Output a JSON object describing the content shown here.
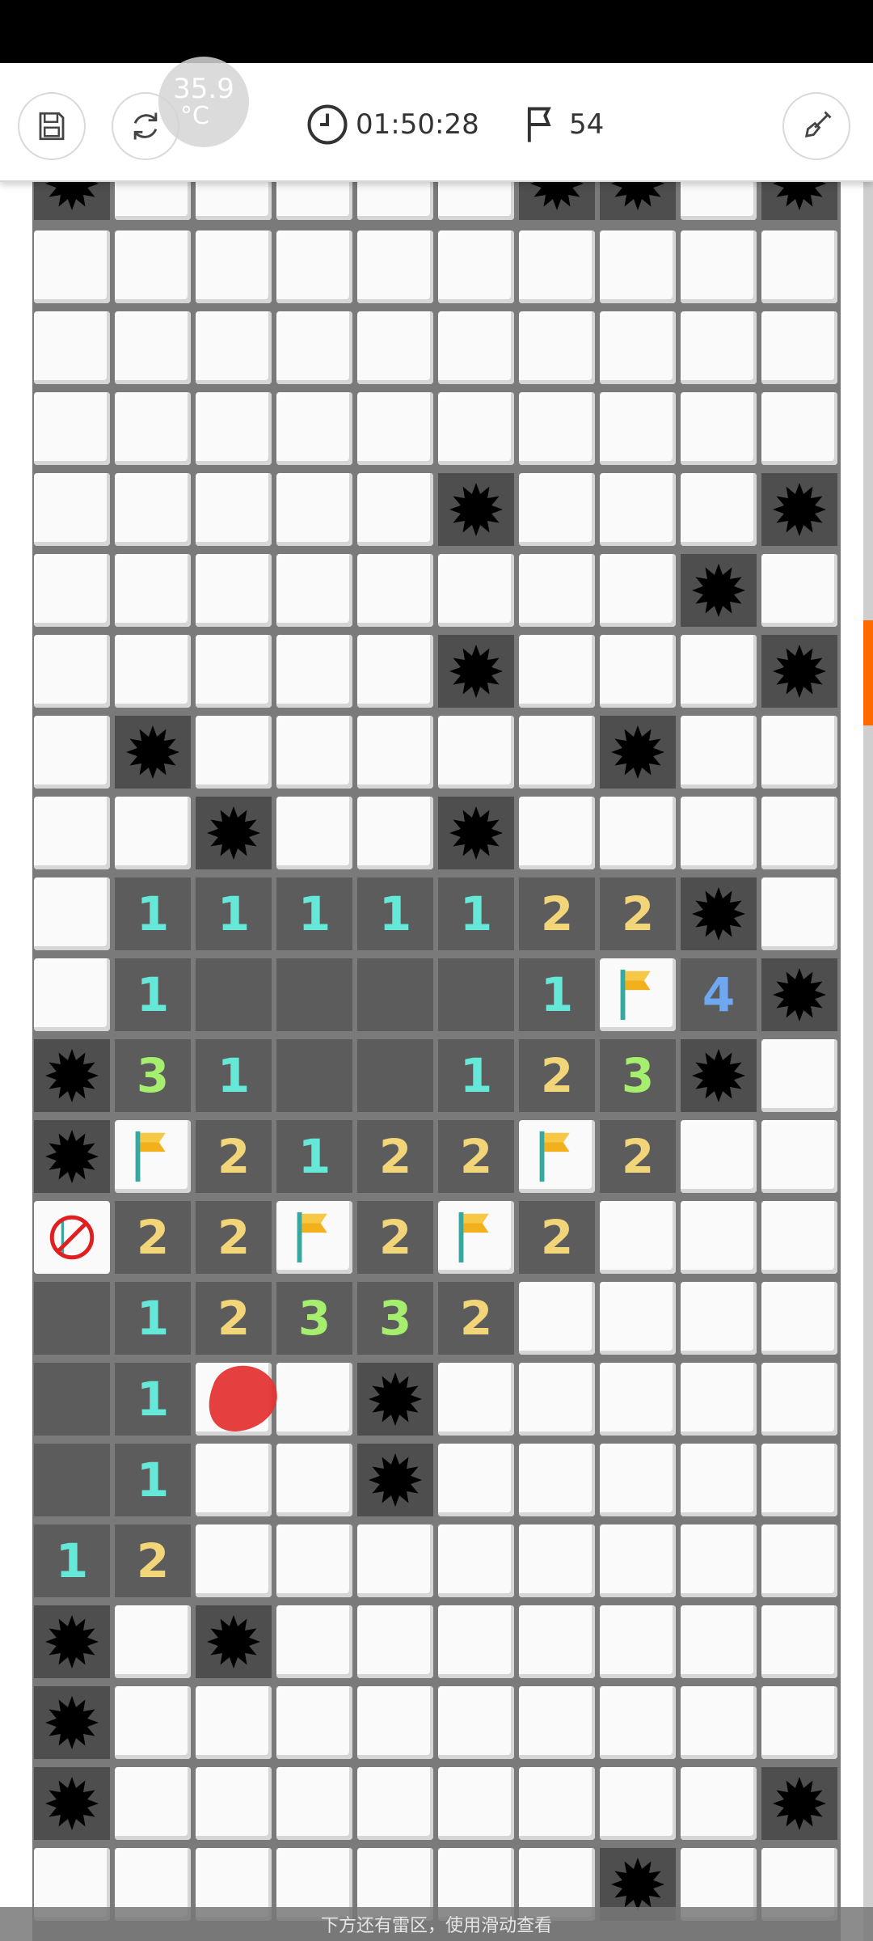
{
  "toolbar": {
    "temperature_value": "35.9",
    "temperature_unit": "°C",
    "timer": "01:50:28",
    "flag_count": "54"
  },
  "hint_text": "下方还有雷区，使用滑动查看",
  "colors": {
    "n1": "#66e8d8",
    "n2": "#f2d479",
    "n3": "#a6ee6e",
    "n4": "#6fa8f0",
    "scroll_thumb": "#ff6a00"
  },
  "scroll": {
    "position_fraction": 0.25,
    "visible_fraction": 0.06
  },
  "board": {
    "legend": "c=covered, o=opened empty, m=mine, f=flag, x=wrong flag, 1-4=number",
    "partial_top_row": [
      "m",
      "c",
      "c",
      "c",
      "c",
      "c",
      "m",
      "m",
      "c",
      "m"
    ],
    "rows": [
      [
        "c",
        "c",
        "c",
        "c",
        "c",
        "c",
        "c",
        "c",
        "c",
        "c"
      ],
      [
        "c",
        "c",
        "c",
        "c",
        "c",
        "c",
        "c",
        "c",
        "c",
        "c"
      ],
      [
        "c",
        "c",
        "c",
        "c",
        "c",
        "c",
        "c",
        "c",
        "c",
        "c"
      ],
      [
        "c",
        "c",
        "c",
        "c",
        "c",
        "m",
        "c",
        "c",
        "c",
        "m"
      ],
      [
        "c",
        "c",
        "c",
        "c",
        "c",
        "c",
        "c",
        "c",
        "m",
        "c"
      ],
      [
        "c",
        "c",
        "c",
        "c",
        "c",
        "m",
        "c",
        "c",
        "c",
        "m"
      ],
      [
        "c",
        "m",
        "c",
        "c",
        "c",
        "c",
        "c",
        "m",
        "c",
        "c"
      ],
      [
        "c",
        "c",
        "m",
        "c",
        "c",
        "m",
        "c",
        "c",
        "c",
        "c"
      ],
      [
        "c",
        "1",
        "1",
        "1",
        "1",
        "1",
        "2",
        "2",
        "m",
        "c"
      ],
      [
        "c",
        "1",
        "o",
        "o",
        "o",
        "o",
        "1",
        "f",
        "4",
        "m"
      ],
      [
        "m",
        "3",
        "1",
        "o",
        "o",
        "1",
        "2",
        "3",
        "m",
        "c"
      ],
      [
        "m",
        "f",
        "2",
        "1",
        "2",
        "2",
        "f",
        "2",
        "c",
        "c"
      ],
      [
        "x",
        "2",
        "2",
        "f",
        "2",
        "f",
        "2",
        "c",
        "c",
        "c"
      ],
      [
        "o",
        "1",
        "2",
        "3",
        "3",
        "2",
        "c",
        "c",
        "c",
        "c"
      ],
      [
        "o",
        "1",
        "c",
        "c",
        "m",
        "c",
        "c",
        "c",
        "c",
        "c"
      ],
      [
        "o",
        "1",
        "c",
        "c",
        "m",
        "c",
        "c",
        "c",
        "c",
        "c"
      ],
      [
        "1",
        "2",
        "c",
        "c",
        "c",
        "c",
        "c",
        "c",
        "c",
        "c"
      ],
      [
        "m",
        "c",
        "m",
        "c",
        "c",
        "c",
        "c",
        "c",
        "c",
        "c"
      ],
      [
        "m",
        "c",
        "c",
        "c",
        "c",
        "c",
        "c",
        "c",
        "c",
        "c"
      ],
      [
        "m",
        "c",
        "c",
        "c",
        "c",
        "c",
        "c",
        "c",
        "c",
        "m"
      ],
      [
        "c",
        "c",
        "c",
        "c",
        "c",
        "c",
        "c",
        "m",
        "c",
        "c"
      ]
    ]
  }
}
